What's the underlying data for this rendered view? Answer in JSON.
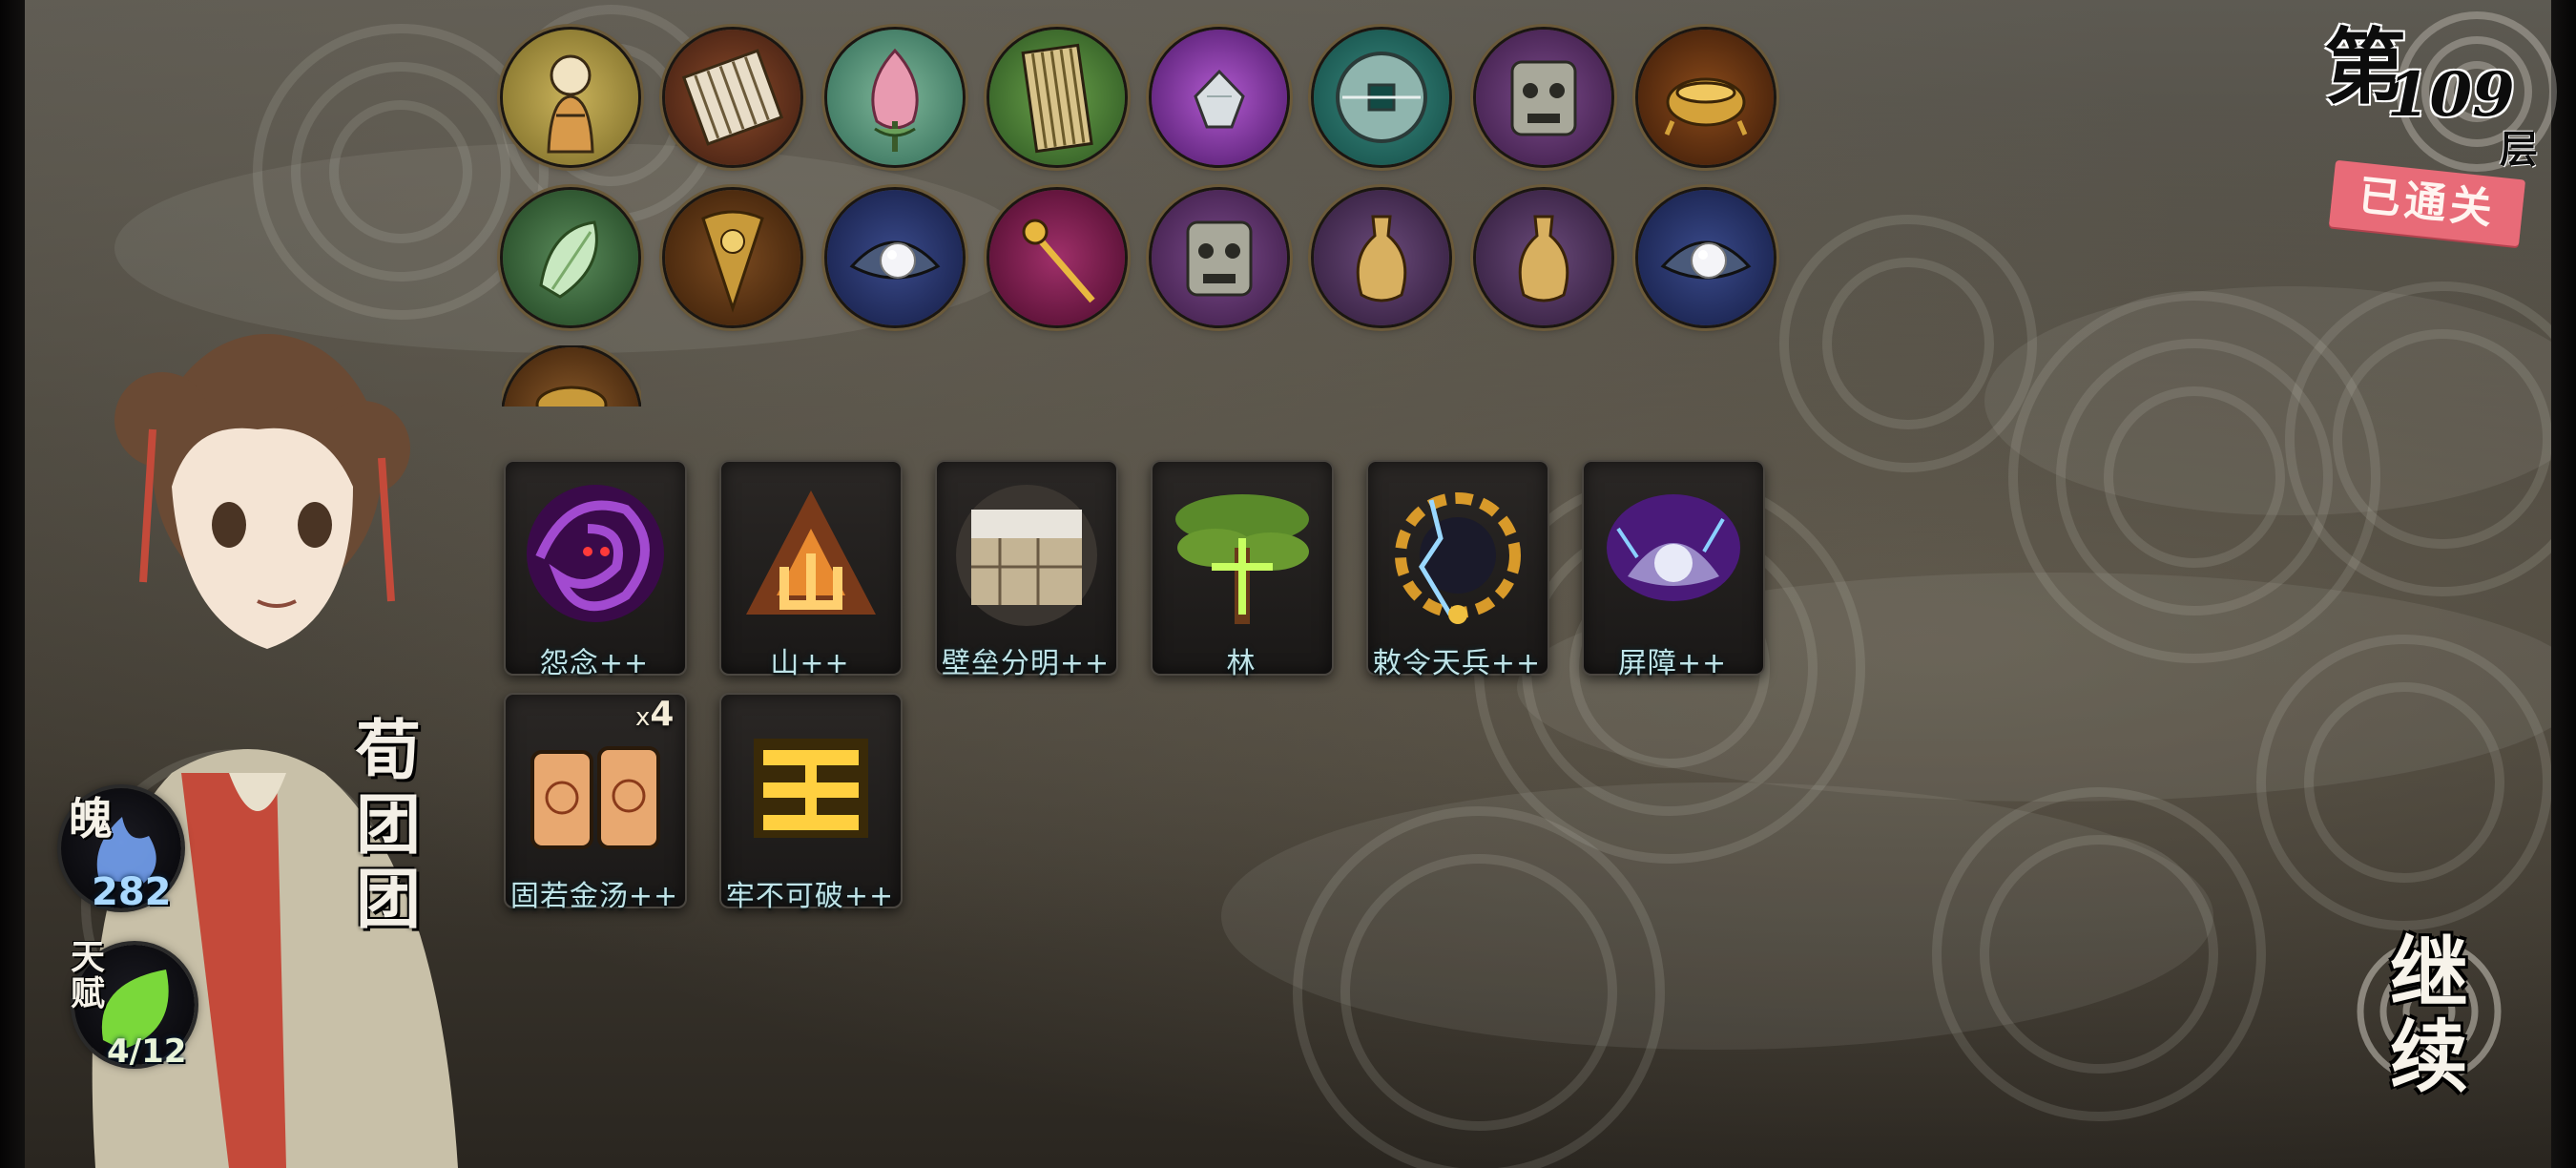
{
  "floor": {
    "prefix": "第",
    "number": "109",
    "suffix": "层",
    "status": "已通关"
  },
  "relics": {
    "row1": [
      "doll-figure-icon",
      "bamboo-scroll-icon",
      "lotus-bud-icon",
      "bamboo-slip-book-icon",
      "purple-gem-icon",
      "bronze-coin-icon",
      "bronze-mask-icon",
      "gold-censer-icon"
    ],
    "row2": [
      "jade-cabbage-icon",
      "gold-fan-icon",
      "pearl-shell-icon",
      "gold-scepter-icon",
      "bronze-mask-icon",
      "gold-vase-icon",
      "gold-vase-icon",
      "pearl-shell-icon"
    ],
    "row3": [
      "partial-relic-icon"
    ]
  },
  "skills": [
    {
      "label": "怨念++",
      "icon": "resentment-vortex-icon"
    },
    {
      "label": "山++",
      "icon": "mountain-glyph-icon"
    },
    {
      "label": "壁垒分明++",
      "icon": "fortress-wall-icon"
    },
    {
      "label": "林",
      "icon": "forest-tree-icon"
    },
    {
      "label": "敕令天兵++",
      "icon": "heavenly-decree-icon"
    },
    {
      "label": "屏障++",
      "icon": "barrier-lotus-icon"
    },
    {
      "label": "固若金汤++",
      "icon": "lantern-pair-icon",
      "stack_prefix": "x",
      "stack_count": "4"
    },
    {
      "label": "牢不可破++",
      "icon": "golden-seal-icon"
    }
  ],
  "character": {
    "name": "荀团团",
    "soul_label": "魄",
    "soul_value": "282",
    "talent_label": "天赋",
    "talent_value": "4/12"
  },
  "continue_label": "继续",
  "colors": {
    "label_text": "#bfe4e8",
    "cleared_stamp": "#e86b78",
    "soul_value": "#a9d8ff"
  }
}
